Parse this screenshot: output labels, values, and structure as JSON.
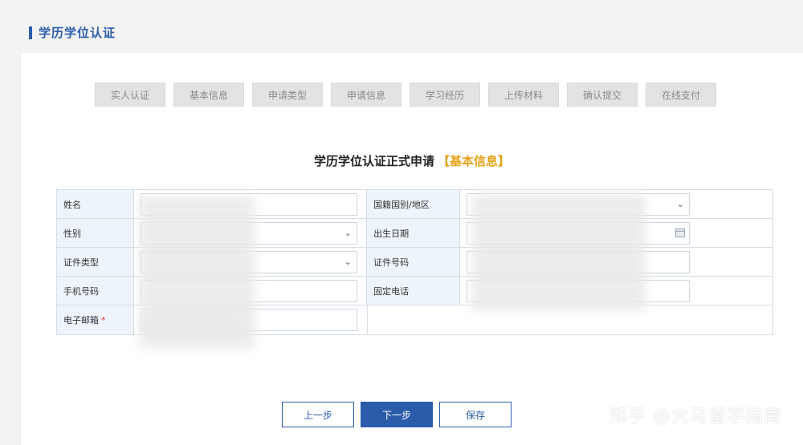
{
  "header": {
    "title": "学历学位认证"
  },
  "steps": [
    "实人认证",
    "基本信息",
    "申请类型",
    "申请信息",
    "学习经历",
    "上传材料",
    "确认提交",
    "在线支付"
  ],
  "form": {
    "title": "学历学位认证正式申请",
    "highlight": "【基本信息】",
    "rows": [
      {
        "label1": "姓名",
        "label2": "国籍国别/地区"
      },
      {
        "label1": "性别",
        "label2": "出生日期"
      },
      {
        "label1": "证件类型",
        "label2": "证件号码"
      },
      {
        "label1": "手机号码",
        "label2": "固定电话"
      },
      {
        "label1": "电子邮箱",
        "required": "*"
      }
    ]
  },
  "icons": {
    "dropdown": "chevron-down-icon",
    "calendar": "calendar-icon"
  },
  "buttons": {
    "prev": "上一步",
    "next": "下一步",
    "save": "保存"
  },
  "watermark": "知乎 @大马留学指南",
  "colors": {
    "accent": "#2a5caa",
    "highlight": "#e6a21a",
    "label_bg": "#eef4fb"
  }
}
